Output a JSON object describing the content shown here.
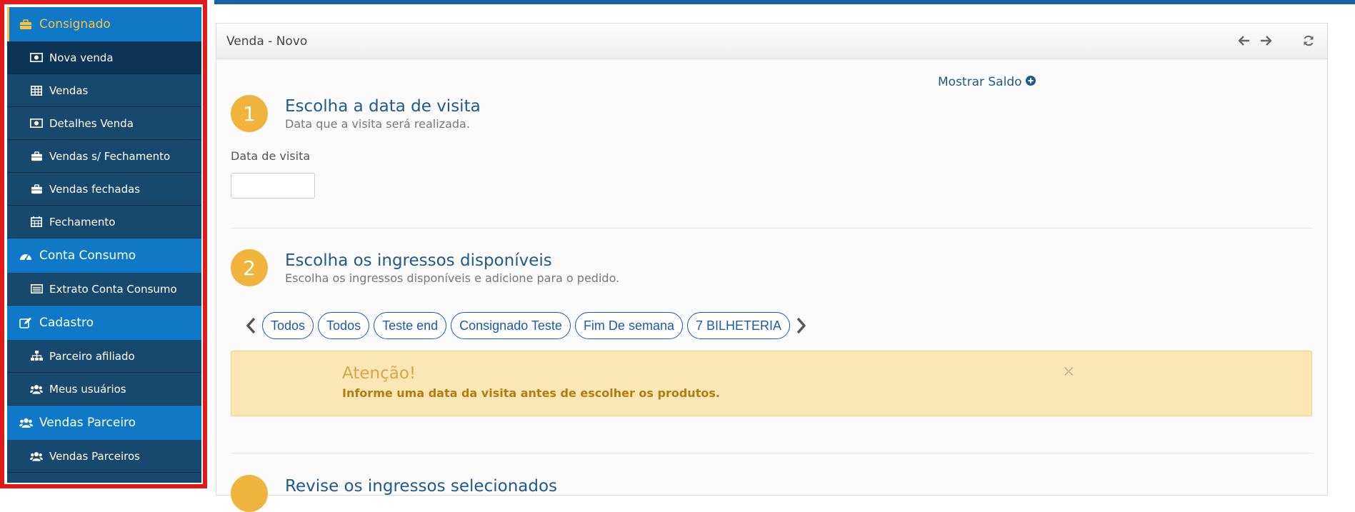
{
  "sidebar": {
    "sections": [
      {
        "label": "Consignado",
        "icon": "briefcase-icon",
        "items": [
          {
            "label": "Nova venda",
            "icon": "money-icon"
          },
          {
            "label": "Vendas",
            "icon": "table-icon"
          },
          {
            "label": "Detalhes Venda",
            "icon": "money-icon"
          },
          {
            "label": "Vendas s/ Fechamento",
            "icon": "briefcase-icon"
          },
          {
            "label": "Vendas fechadas",
            "icon": "briefcase-icon"
          },
          {
            "label": "Fechamento",
            "icon": "calendar-icon"
          }
        ]
      },
      {
        "label": "Conta Consumo",
        "icon": "dashboard-icon",
        "items": [
          {
            "label": "Extrato Conta Consumo",
            "icon": "list-icon"
          }
        ]
      },
      {
        "label": "Cadastro",
        "icon": "edit-icon",
        "items": [
          {
            "label": "Parceiro afiliado",
            "icon": "sitemap-icon"
          },
          {
            "label": "Meus usuários",
            "icon": "users-icon"
          }
        ]
      },
      {
        "label": "Vendas Parceiro",
        "icon": "users-icon",
        "items": [
          {
            "label": "Vendas Parceiros",
            "icon": "users-icon"
          }
        ]
      }
    ]
  },
  "panel": {
    "title": "Venda - Novo",
    "show_balance": "Mostrar Saldo"
  },
  "step1": {
    "number": "1",
    "title": "Escolha a data de visita",
    "subtitle": "Data que a visita será realizada.",
    "field_label": "Data de visita",
    "field_value": ""
  },
  "step2": {
    "number": "2",
    "title": "Escolha os ingressos disponíveis",
    "subtitle": "Escolha os ingressos disponíveis e adicione para o pedido.",
    "chips": [
      "Todos",
      "Todos",
      "Teste end",
      "Consignado Teste",
      "Fim De semana",
      "7 BILHETERIA"
    ]
  },
  "alert": {
    "title": "Atenção!",
    "message": "Informe uma data da visita antes de escolher os produtos.",
    "close": "×"
  },
  "step3": {
    "title": "Revise os ingressos selecionados"
  },
  "colors": {
    "sidebar_section": "#0f79c7",
    "sidebar_item": "#17496f",
    "active": "#f6c343",
    "step_circle": "#f0b33c",
    "highlight_border": "#e0191b"
  }
}
